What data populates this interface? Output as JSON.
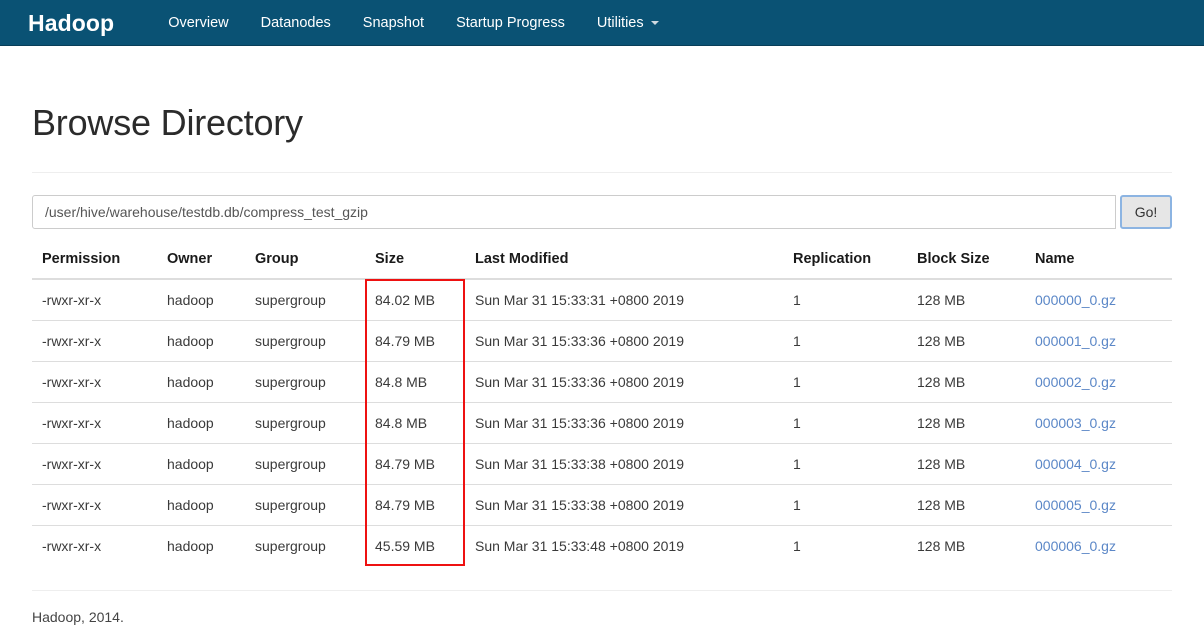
{
  "navbar": {
    "brand": "Hadoop",
    "items": [
      {
        "label": "Overview",
        "dropdown": false
      },
      {
        "label": "Datanodes",
        "dropdown": false
      },
      {
        "label": "Snapshot",
        "dropdown": false
      },
      {
        "label": "Startup Progress",
        "dropdown": false
      },
      {
        "label": "Utilities",
        "dropdown": true
      }
    ],
    "background_color": "#0a5274"
  },
  "page": {
    "title": "Browse Directory"
  },
  "path_bar": {
    "value": "/user/hive/warehouse/testdb.db/compress_test_gzip",
    "placeholder": "Enter path",
    "go_label": "Go!"
  },
  "table": {
    "headers": [
      "Permission",
      "Owner",
      "Group",
      "Size",
      "Last Modified",
      "Replication",
      "Block Size",
      "Name"
    ],
    "rows": [
      {
        "permission": "-rwxr-xr-x",
        "owner": "hadoop",
        "group": "supergroup",
        "size": "84.02 MB",
        "modified": "Sun Mar 31 15:33:31 +0800 2019",
        "replication": "1",
        "block_size": "128 MB",
        "name": "000000_0.gz"
      },
      {
        "permission": "-rwxr-xr-x",
        "owner": "hadoop",
        "group": "supergroup",
        "size": "84.79 MB",
        "modified": "Sun Mar 31 15:33:36 +0800 2019",
        "replication": "1",
        "block_size": "128 MB",
        "name": "000001_0.gz"
      },
      {
        "permission": "-rwxr-xr-x",
        "owner": "hadoop",
        "group": "supergroup",
        "size": "84.8 MB",
        "modified": "Sun Mar 31 15:33:36 +0800 2019",
        "replication": "1",
        "block_size": "128 MB",
        "name": "000002_0.gz"
      },
      {
        "permission": "-rwxr-xr-x",
        "owner": "hadoop",
        "group": "supergroup",
        "size": "84.8 MB",
        "modified": "Sun Mar 31 15:33:36 +0800 2019",
        "replication": "1",
        "block_size": "128 MB",
        "name": "000003_0.gz"
      },
      {
        "permission": "-rwxr-xr-x",
        "owner": "hadoop",
        "group": "supergroup",
        "size": "84.79 MB",
        "modified": "Sun Mar 31 15:33:38 +0800 2019",
        "replication": "1",
        "block_size": "128 MB",
        "name": "000004_0.gz"
      },
      {
        "permission": "-rwxr-xr-x",
        "owner": "hadoop",
        "group": "supergroup",
        "size": "84.79 MB",
        "modified": "Sun Mar 31 15:33:38 +0800 2019",
        "replication": "1",
        "block_size": "128 MB",
        "name": "000005_0.gz"
      },
      {
        "permission": "-rwxr-xr-x",
        "owner": "hadoop",
        "group": "supergroup",
        "size": "45.59 MB",
        "modified": "Sun Mar 31 15:33:48 +0800 2019",
        "replication": "1",
        "block_size": "128 MB",
        "name": "000006_0.gz"
      }
    ]
  },
  "annotation": {
    "highlight_color": "#ee1111",
    "highlight_target_column": "Size"
  },
  "footer": {
    "text": "Hadoop, 2014."
  }
}
